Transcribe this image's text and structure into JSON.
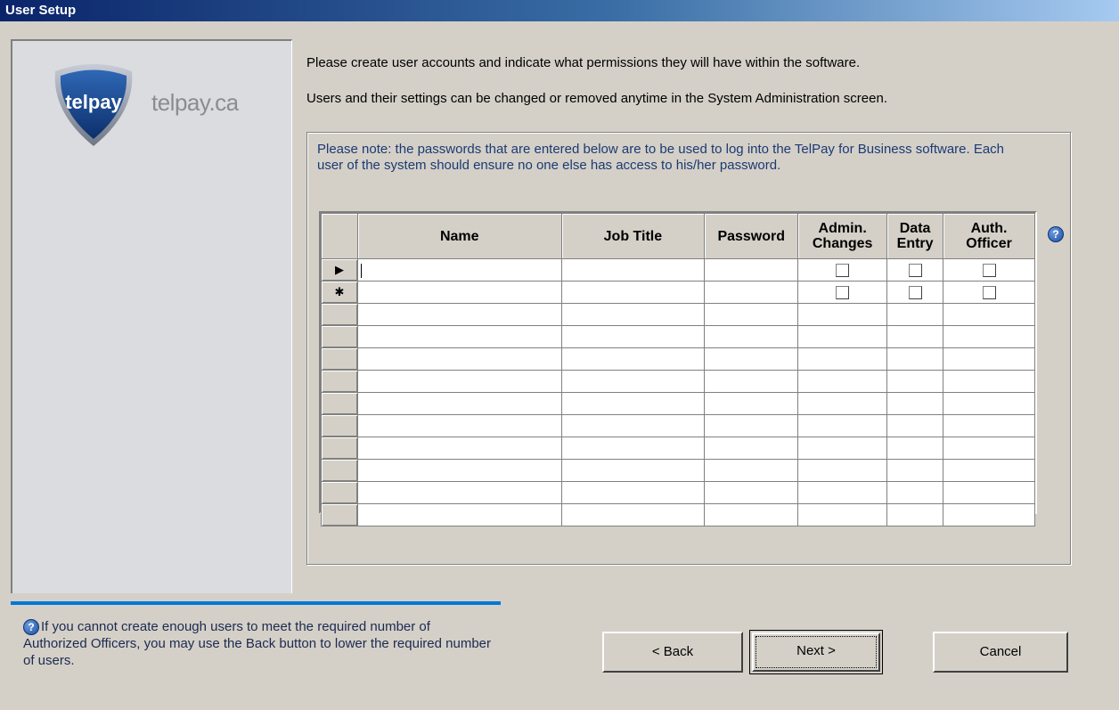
{
  "window": {
    "title": "User Setup"
  },
  "logo": {
    "badge_text": "telpay",
    "domain": "telpay.ca"
  },
  "intro": {
    "line1": "Please create user accounts and indicate what permissions they will have within the software.",
    "line2": "Users and their settings can be changed or removed anytime in the System Administration screen."
  },
  "note": "Please note: the passwords that are entered below are to be used to log into the TelPay for Business software. Each user of the system should ensure no one else has access to his/her password.",
  "grid": {
    "columns": {
      "name": "Name",
      "job_title": "Job Title",
      "password": "Password",
      "admin_changes_1": "Admin.",
      "admin_changes_2": "Changes",
      "data_entry_1": "Data",
      "data_entry_2": "Entry",
      "auth_officer_1": "Auth.",
      "auth_officer_2": "Officer"
    },
    "row_selectors": {
      "current": "▶",
      "new": "✱"
    }
  },
  "help": {
    "text": "If you cannot create enough users to meet the required number of Authorized Officers, you may use the Back button to lower the required number of users."
  },
  "buttons": {
    "back": "< Back",
    "next": "Next >",
    "cancel": "Cancel"
  },
  "colors": {
    "title_bar_start": "#0a246a",
    "title_bar_end": "#a6caf0",
    "accent_line": "#0078d7",
    "note_text": "#1c3a73"
  }
}
